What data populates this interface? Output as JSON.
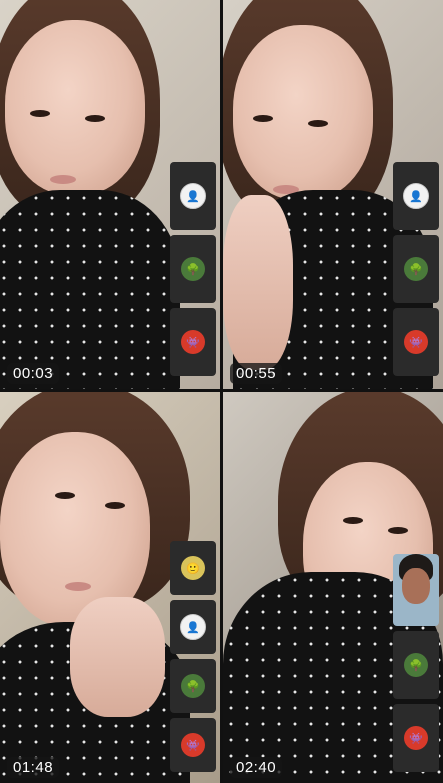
{
  "tiles": [
    {
      "timer": "00:03"
    },
    {
      "timer": "00:55"
    },
    {
      "timer": "01:48"
    },
    {
      "timer": "02:40"
    }
  ],
  "participants": {
    "avatar_1": "person-avatar",
    "avatar_2": "landscape-avatar",
    "avatar_3": "red-character-avatar",
    "avatar_4": "round-avatar"
  },
  "colors": {
    "background": "#111111",
    "timer_bg": "rgba(20,20,20,0.78)",
    "timer_text": "#ffffff",
    "shirt": "#121212"
  }
}
